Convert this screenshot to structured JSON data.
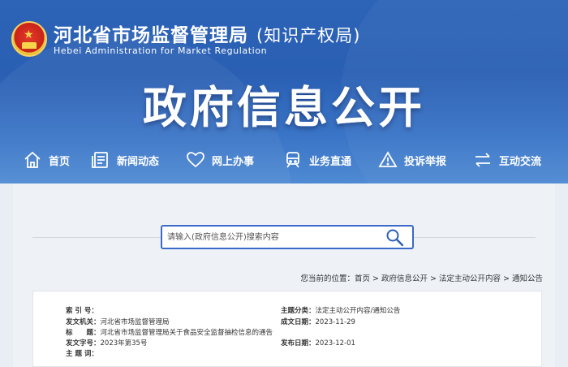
{
  "header": {
    "org_name_cn": "河北省市场监督管理局",
    "org_name_paren": "(知识产权局)",
    "org_name_en": "Hebei Administration for Market Regulation",
    "section_title": "政府信息公开"
  },
  "nav": {
    "items": [
      {
        "label": "首页",
        "icon": "home-icon"
      },
      {
        "label": "新闻动态",
        "icon": "news-icon"
      },
      {
        "label": "网上办事",
        "icon": "heart-hand-icon"
      },
      {
        "label": "业务直通",
        "icon": "train-icon"
      },
      {
        "label": "投诉举报",
        "icon": "warning-icon"
      },
      {
        "label": "互动交流",
        "icon": "exchange-icon"
      }
    ]
  },
  "search": {
    "placeholder": "请输入(政府信息公开)搜索内容"
  },
  "breadcrumb": {
    "prefix": "您当前的位置：",
    "items": [
      "首页",
      "政府信息公开",
      "法定主动公开内容",
      "通知公告"
    ],
    "separator": ">"
  },
  "doc_info": {
    "index_label": "索 引 号：",
    "index_value": "",
    "issuer_label": "发文机关：",
    "issuer_value": "河北省市场监督管理局",
    "title_label": "标　　题：",
    "title_value": "河北省市场监督管理局关于食品安全监督抽检信息的通告",
    "docno_label": "发文字号：",
    "docno_value": "2023年第35号",
    "subject_label": "主 题 词：",
    "subject_value": "",
    "category_label": "主题分类：",
    "category_value": "法定主动公开内容/通知公告",
    "created_label": "成文日期：",
    "created_value": "2023-11-29",
    "published_label": "发布日期：",
    "published_value": "2023-12-01"
  },
  "colors": {
    "header_blue": "#2d64b8",
    "search_border": "#3a69c9"
  }
}
